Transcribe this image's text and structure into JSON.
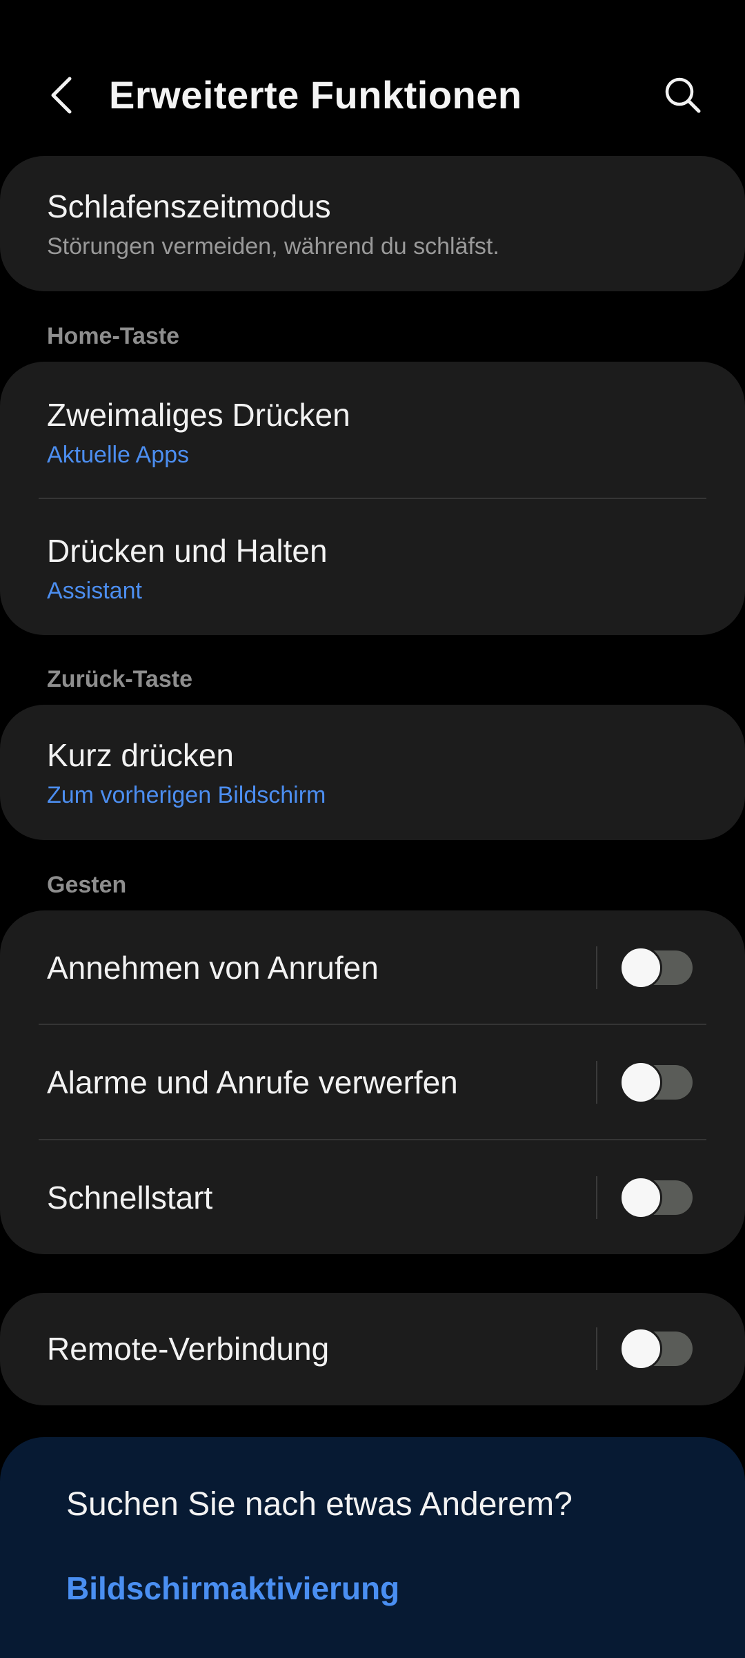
{
  "header": {
    "title": "Erweiterte Funktionen",
    "back_icon": "chevron-left-icon",
    "search_icon": "search-icon"
  },
  "bedtime": {
    "title": "Schlafenszeitmodus",
    "subtitle": "Störungen vermeiden, während du schläfst."
  },
  "home_key": {
    "header": "Home-Taste",
    "items": [
      {
        "title": "Zweimaliges Drücken",
        "value": "Aktuelle Apps"
      },
      {
        "title": "Drücken und Halten",
        "value": "Assistant"
      }
    ]
  },
  "back_key": {
    "header": "Zurück-Taste",
    "items": [
      {
        "title": "Kurz drücken",
        "value": "Zum vorherigen Bildschirm"
      }
    ]
  },
  "gestures": {
    "header": "Gesten",
    "items": [
      {
        "title": "Annehmen von Anrufen",
        "enabled": false
      },
      {
        "title": "Alarme und Anrufe verwerfen",
        "enabled": false
      },
      {
        "title": "Schnellstart",
        "enabled": false
      }
    ]
  },
  "remote": {
    "title": "Remote-Verbindung",
    "enabled": false
  },
  "suggestion": {
    "title": "Suchen Sie nach etwas Anderem?",
    "link": "Bildschirmaktivierung"
  },
  "colors": {
    "background": "#000000",
    "card": "#1c1c1c",
    "accent_blue": "#4c8ef0",
    "suggestion_card": "#071a33",
    "toggle_off_track": "#5a5c58"
  }
}
